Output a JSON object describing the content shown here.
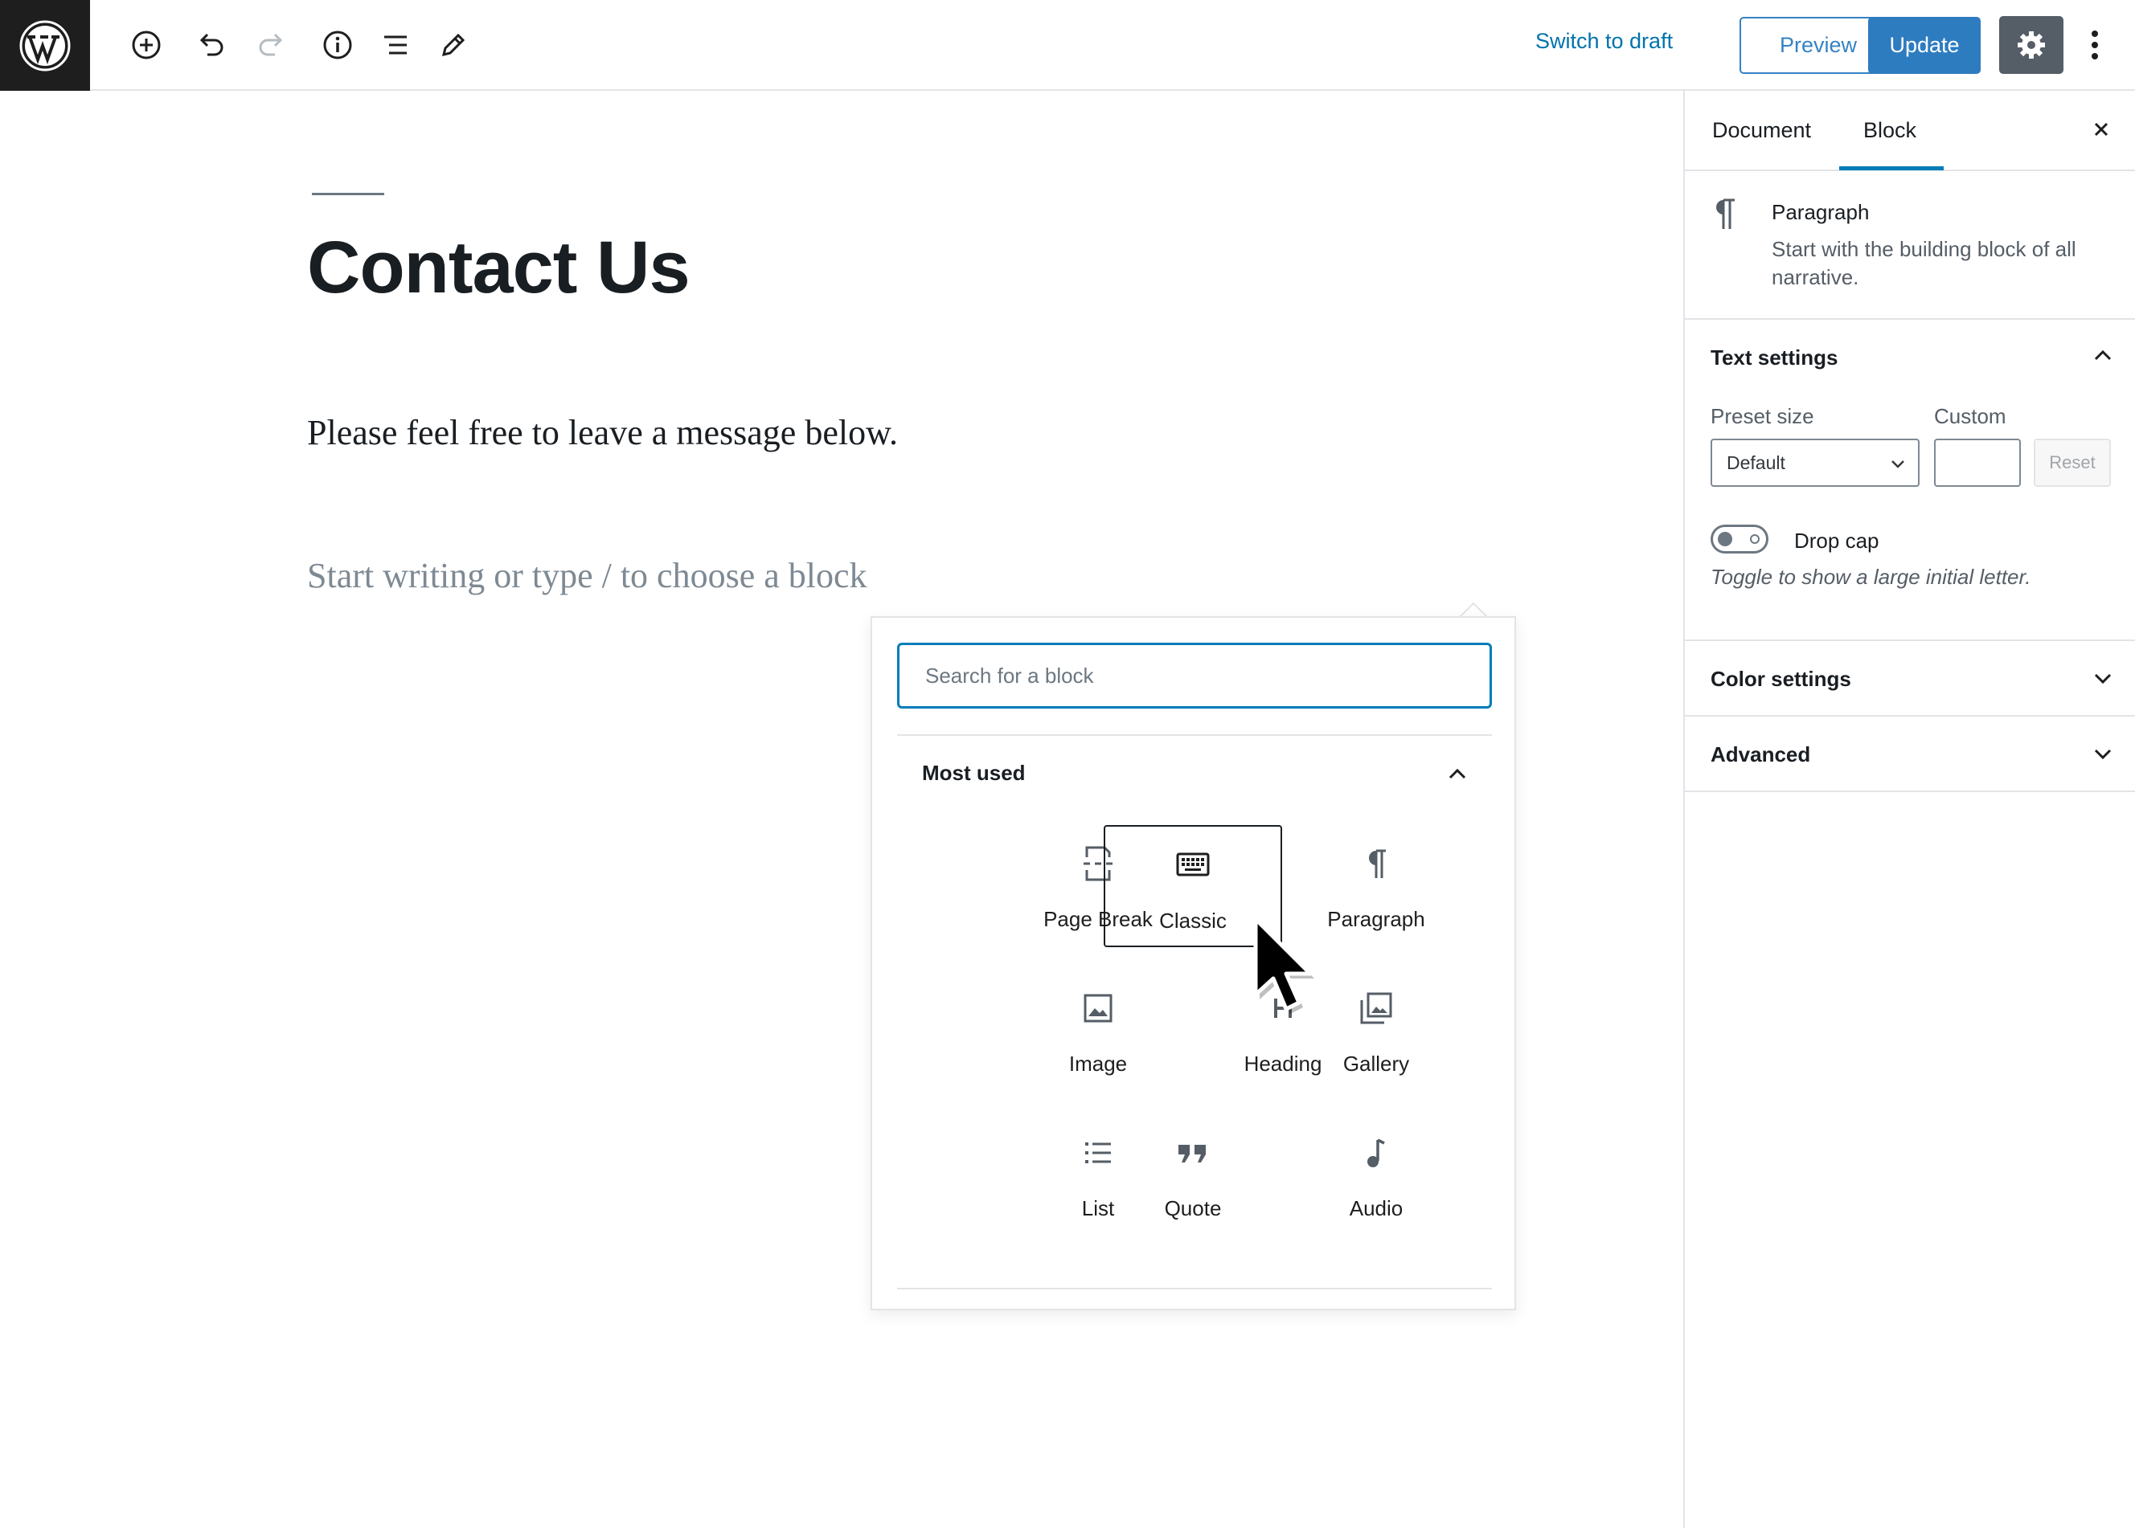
{
  "topbar": {
    "switch_to_draft": "Switch to draft",
    "preview": "Preview",
    "update": "Update",
    "icons": [
      "wordpress-logo",
      "add-block",
      "undo",
      "redo",
      "info",
      "outline",
      "tools-edit",
      "settings-gear",
      "more-options"
    ],
    "colors": {
      "accent": "#007cba",
      "update_bg": "#2e7cc0",
      "gear_bg": "#555d66",
      "logo_bg": "#1e1e1e"
    }
  },
  "editor": {
    "title": "Contact Us",
    "paragraph": "Please feel free to leave a message below.",
    "placeholder": "Start writing or type / to choose a block"
  },
  "inserter": {
    "search_placeholder": "Search for a block",
    "panel_title": "Most used",
    "blocks": [
      {
        "label": "Page Break",
        "icon": "page-break-icon"
      },
      {
        "label": "Classic",
        "icon": "keyboard-icon"
      },
      {
        "label": "Paragraph",
        "icon": "pilcrow-icon"
      },
      {
        "label": "Image",
        "icon": "image-icon"
      },
      {
        "label": "Heading",
        "icon": "heading-icon"
      },
      {
        "label": "Gallery",
        "icon": "gallery-icon"
      },
      {
        "label": "List",
        "icon": "list-icon"
      },
      {
        "label": "Quote",
        "icon": "quote-icon"
      },
      {
        "label": "Audio",
        "icon": "audio-icon"
      }
    ],
    "hovered_block": "Classic"
  },
  "sidebar": {
    "tabs": [
      {
        "label": "Document",
        "active": false
      },
      {
        "label": "Block",
        "active": true
      }
    ],
    "block_card": {
      "title": "Paragraph",
      "description": "Start with the building block of all narrative."
    },
    "text_settings": {
      "title": "Text settings",
      "preset_label": "Preset size",
      "preset_value": "Default",
      "custom_label": "Custom",
      "custom_value": "",
      "reset": "Reset",
      "drop_cap_label": "Drop cap",
      "drop_cap_help": "Toggle to show a large initial letter.",
      "drop_cap_on": false
    },
    "color_settings": {
      "title": "Color settings"
    },
    "advanced": {
      "title": "Advanced"
    }
  }
}
